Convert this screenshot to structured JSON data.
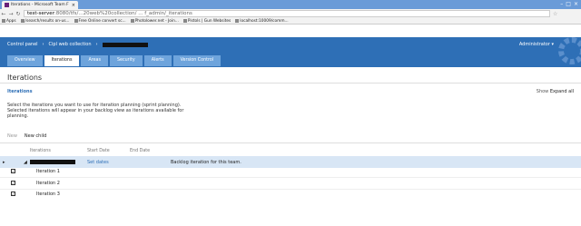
{
  "browser": {
    "tab_title": "Iterations - Microsoft Team F",
    "url_prefix": "test-server",
    "url_rest": ":8080/tfs/...20web%20collection/ ... f_admin/_iterations",
    "bookmarks": [
      {
        "label": "Apps"
      },
      {
        "label": "/search/results on-us..."
      },
      {
        "label": "Free Online convert sc..."
      },
      {
        "label": "Photolower.net - Join..."
      },
      {
        "label": "Pistols | Gun Websites"
      },
      {
        "label": "localhost:10009/comm..."
      }
    ]
  },
  "header": {
    "control_panel": "Control panel",
    "collection": "Cipl web collection",
    "admin": "Administrator ▾"
  },
  "tabs": [
    {
      "label": "Overview"
    },
    {
      "label": "Iterations"
    },
    {
      "label": "Areas"
    },
    {
      "label": "Security"
    },
    {
      "label": "Alerts"
    },
    {
      "label": "Version Control"
    }
  ],
  "page": {
    "title": "Iterations",
    "section_title": "Iterations",
    "show_label": "Show",
    "expand_all": "Expand all",
    "description": "Select the iterations you want to use for iteration planning (sprint planning). Selected iterations will appear in your backlog view as iterations available for planning."
  },
  "toolbar": {
    "new": "New",
    "new_child": "New child"
  },
  "grid": {
    "headers": {
      "iterations": "Iterations",
      "start_date": "Start Date",
      "end_date": "End Date"
    },
    "root": {
      "start": "Set dates",
      "note": "Backlog iteration for this team."
    },
    "rows": [
      {
        "name": "Iteration 1",
        "checked": true
      },
      {
        "name": "Iteration 2",
        "checked": true
      },
      {
        "name": "Iteration 3",
        "checked": true
      }
    ]
  }
}
